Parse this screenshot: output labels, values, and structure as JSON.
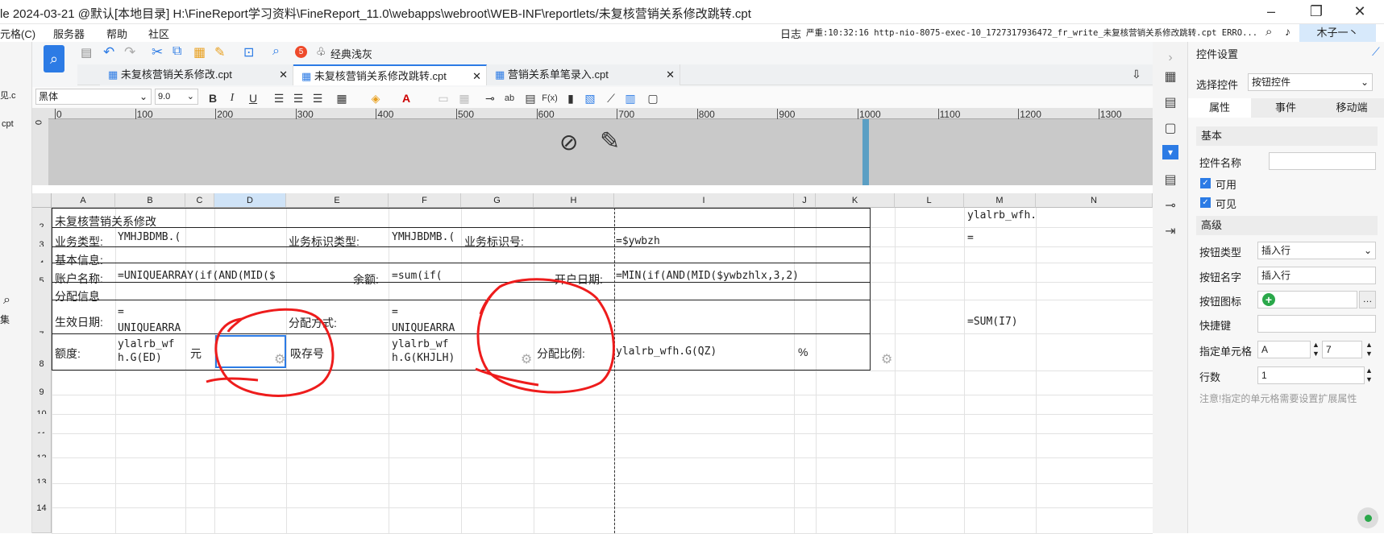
{
  "window": {
    "title": "le 2024-03-21 @默认[本地目录]    H:\\FineReport学习资料\\FineReport_11.0\\webapps\\webroot\\WEB-INF\\reportlets/未复核营销关系修改跳转.cpt"
  },
  "menu": [
    "元格(C)",
    "服务器",
    "帮助",
    "社区"
  ],
  "log": {
    "label": "日志",
    "text": "严重:10:32:16 http-nio-8075-exec-10_1727317936472_fr_write_未复核营销关系修改跳转.cpt ERRO..."
  },
  "user": "木子一丶",
  "toolbar": {
    "notify_count": "5",
    "classic_label": "经典浅灰"
  },
  "tabs": [
    "未复核营销关系修改.cpt",
    "未复核营销关系修改跳转.cpt",
    "营销关系单笔录入.cpt"
  ],
  "format": {
    "font": "黑体",
    "size": "9.0"
  },
  "ruler": {
    "ticks": [
      "0",
      "100",
      "200",
      "300",
      "400",
      "500",
      "600",
      "700",
      "800",
      "900",
      "1000",
      "1100",
      "1200",
      "1300"
    ],
    "left": "0"
  },
  "columns": [
    "A",
    "B",
    "C",
    "D",
    "E",
    "F",
    "G",
    "H",
    "I",
    "J",
    "K",
    "L",
    "M",
    "N"
  ],
  "rows": [
    "1",
    "2",
    "3",
    "4",
    "5",
    "6",
    "7",
    "8",
    "9",
    "10",
    "11",
    "12",
    "13",
    "14"
  ],
  "cells": {
    "r1a": "未复核营销关系修改",
    "r2a": "业务类型:",
    "r2b": "YMHJBDMB.(",
    "r2e": "业务标识类型:",
    "r2f": "YMHJBDMB.(",
    "r2g": "业务标识号:",
    "r2i": "=$ywbzh",
    "r3a": "基本信息:",
    "r4a": "账户名称:",
    "r4b": "=UNIQUEARRAY(if(AND(MID($",
    "r4e": "余额:",
    "r4f": "=sum(if(",
    "r4h": "开户日期:",
    "r4i": "=MIN(if(AND(MID($ywbzhlx,3,2)",
    "r5a": "分配信息",
    "r6a": "生效日期:",
    "r6b1": "=",
    "r6b2": "UNIQUEARRA",
    "r6e": "分配方式:",
    "r6f1": "=",
    "r6f2": "UNIQUEARRA",
    "r7a": "额度:",
    "r7b1": "ylalrb_wf",
    "r7b2": "h.G(ED)",
    "r7c": "元",
    "r7e": "吸存号",
    "r7f1": "ylalrb_wf",
    "r7f2": "h.G(KHJLH)",
    "r7h": "分配比例:",
    "r7i": "ylalrb_wfh.G(QZ)",
    "r7j": "%",
    "m1": "ylalrb_wfh.",
    "m2": "=",
    "m6": "=SUM(I7)"
  },
  "panel": {
    "title": "控件设置",
    "select_label": "选择控件",
    "select_value": "按钮控件",
    "tabs": [
      "属性",
      "事件",
      "移动端"
    ],
    "basic": "基本",
    "name_label": "控件名称",
    "name_value": "",
    "enabled": "可用",
    "visible": "可见",
    "advanced": "高级",
    "btn_type_label": "按钮类型",
    "btn_type_value": "插入行",
    "btn_name_label": "按钮名字",
    "btn_name_value": "插入行",
    "btn_icon_label": "按钮图标",
    "shortcut_label": "快捷键",
    "shortcut_value": "",
    "cell_label": "指定单元格",
    "cell_col": "A",
    "cell_row": "7",
    "rows_label": "行数",
    "rows_value": "1",
    "note": "注意!指定的单元格需要设置扩展属性"
  },
  "colors": {
    "accent": "#2c7be5",
    "annotation": "#ee1c1c"
  }
}
